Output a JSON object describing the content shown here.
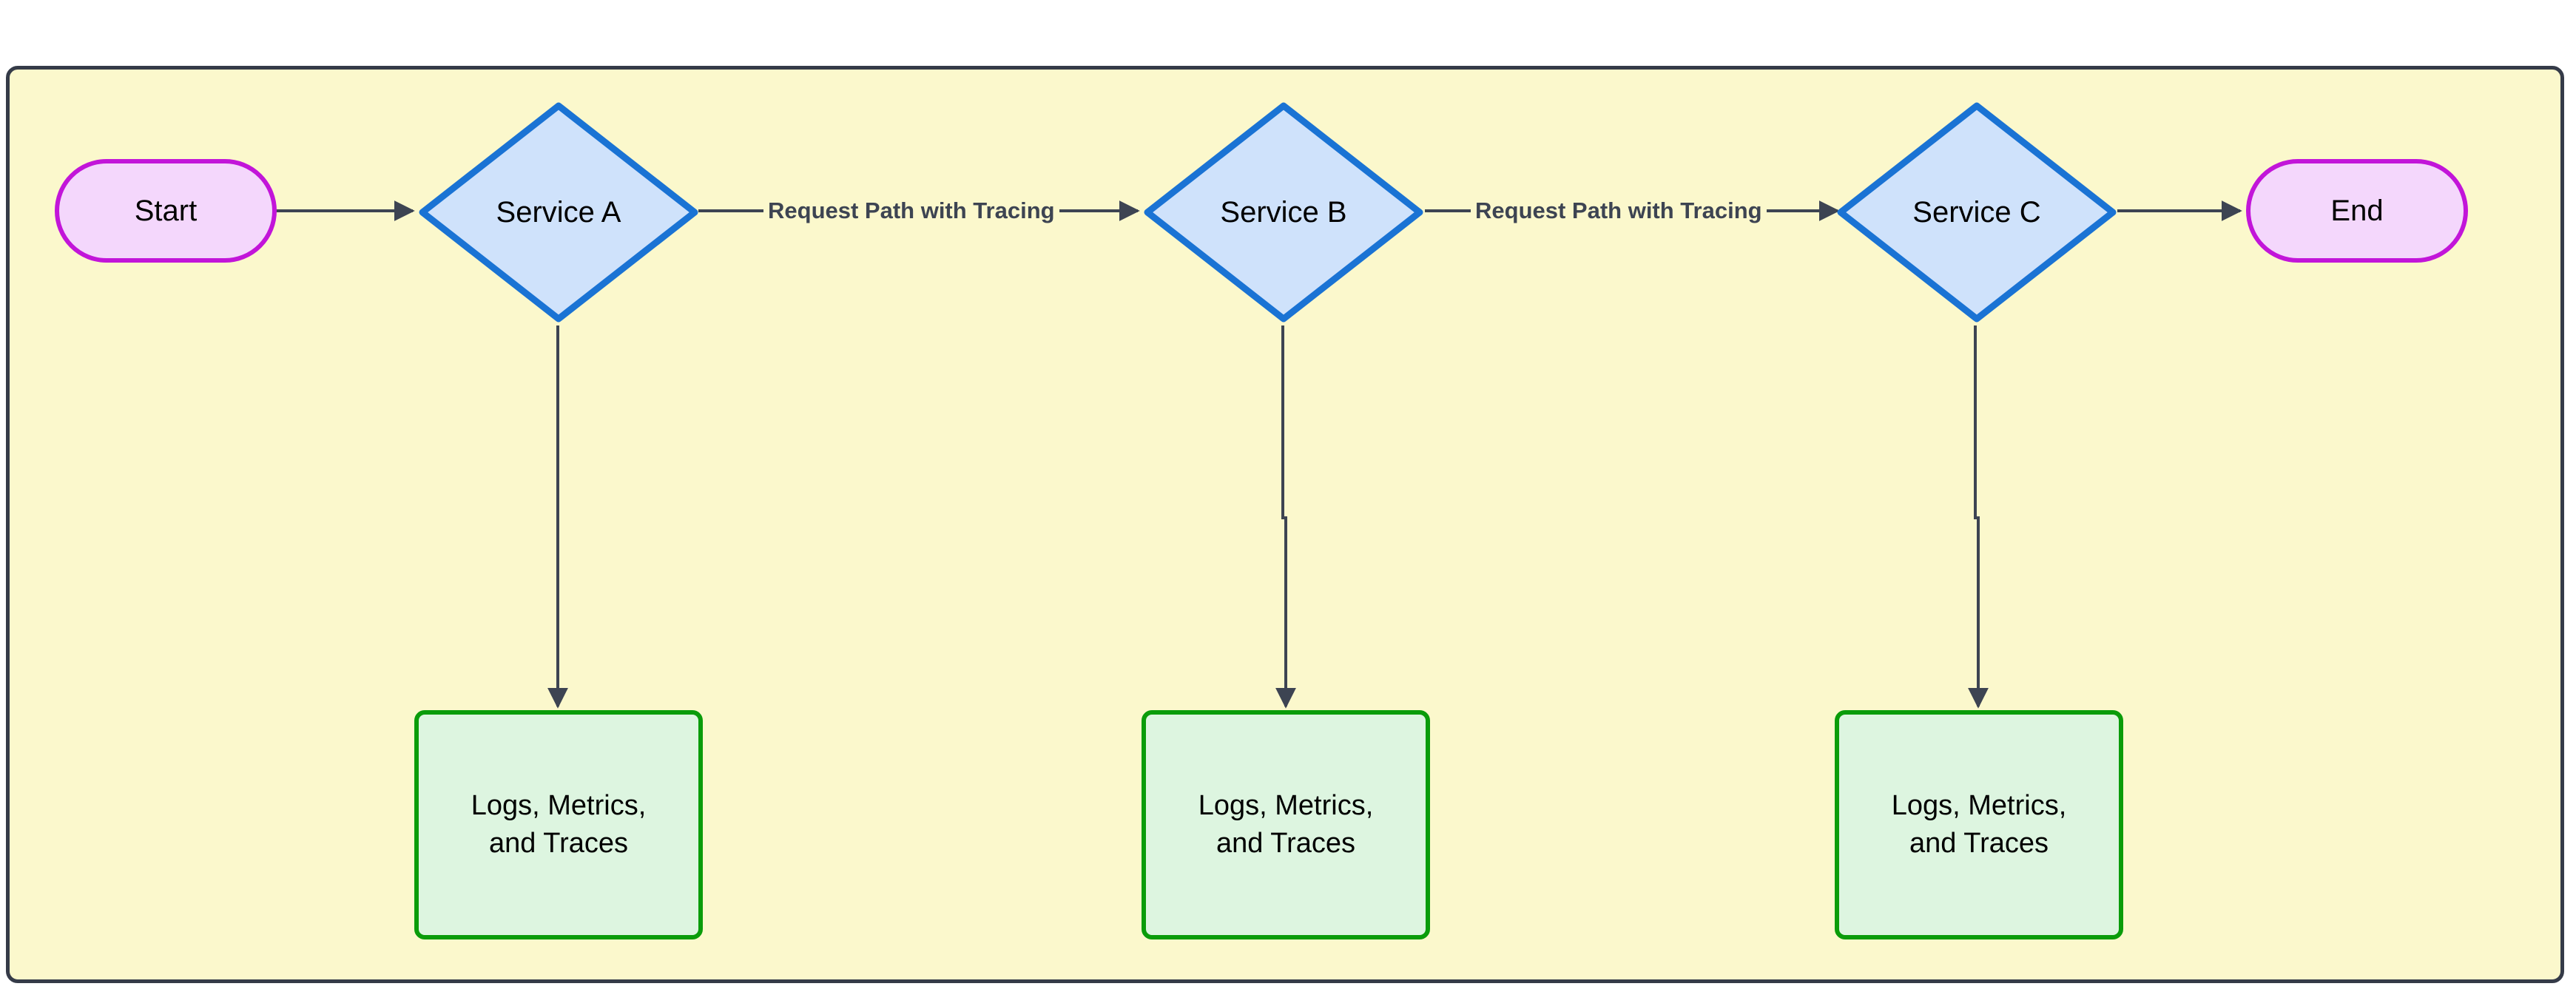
{
  "diagram": {
    "type": "flowchart",
    "direction": "left-to-right",
    "container": {
      "name": "subgraph-container",
      "fill_color": "#fbf8cc",
      "border_color": "#353b48"
    },
    "colors": {
      "canvas_background": "#ffffff",
      "container_fill": "#fbf8cc",
      "container_border": "#353b48",
      "terminator_fill": "#f4d7fc",
      "terminator_border": "#c215d9",
      "decision_fill": "#cfe2fb",
      "decision_border": "#1a73d4",
      "telemetry_fill": "#ddf5e0",
      "telemetry_border": "#0a9c0a",
      "edge_stroke": "#3d4452",
      "edge_label_text": "#3d4452",
      "node_label_text": "#000000"
    },
    "nodes": [
      {
        "id": "start",
        "label": "Start",
        "shape": "stadium"
      },
      {
        "id": "serviceA",
        "label": "Service A",
        "shape": "diamond"
      },
      {
        "id": "serviceB",
        "label": "Service B",
        "shape": "diamond"
      },
      {
        "id": "serviceC",
        "label": "Service C",
        "shape": "diamond"
      },
      {
        "id": "end",
        "label": "End",
        "shape": "stadium"
      },
      {
        "id": "telemetryA",
        "label_line1": "Logs, Metrics,",
        "label_line2": "and Traces",
        "shape": "rounded-rect"
      },
      {
        "id": "telemetryB",
        "label_line1": "Logs, Metrics,",
        "label_line2": "and Traces",
        "shape": "rounded-rect"
      },
      {
        "id": "telemetryC",
        "label_line1": "Logs, Metrics,",
        "label_line2": "and Traces",
        "shape": "rounded-rect"
      }
    ],
    "edges": [
      {
        "from": "start",
        "to": "serviceA",
        "label": ""
      },
      {
        "from": "serviceA",
        "to": "serviceB",
        "label": "Request Path with Tracing"
      },
      {
        "from": "serviceB",
        "to": "serviceC",
        "label": "Request Path with Tracing"
      },
      {
        "from": "serviceC",
        "to": "end",
        "label": ""
      },
      {
        "from": "serviceA",
        "to": "telemetryA",
        "label": ""
      },
      {
        "from": "serviceB",
        "to": "telemetryB",
        "label": ""
      },
      {
        "from": "serviceC",
        "to": "telemetryC",
        "label": ""
      }
    ],
    "edge_labels": {
      "a_to_b": "Request Path with Tracing",
      "b_to_c": "Request Path with Tracing"
    }
  }
}
